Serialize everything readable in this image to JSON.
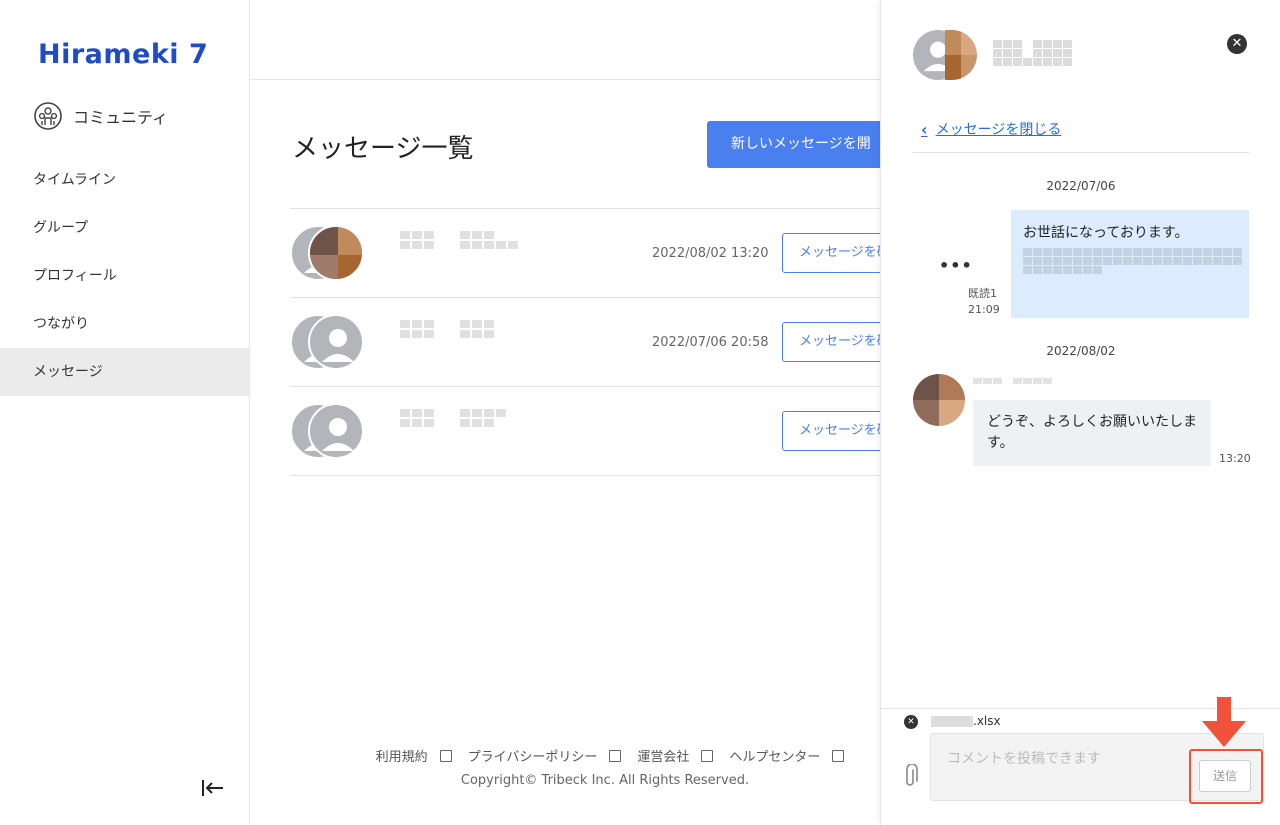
{
  "sidebar": {
    "logo": "Hirameki 7",
    "community": "コミュニティ",
    "items": [
      {
        "label": "タイムライン"
      },
      {
        "label": "グループ"
      },
      {
        "label": "プロフィール"
      },
      {
        "label": "つながり"
      },
      {
        "label": "メッセージ"
      }
    ],
    "active": "メッセージ",
    "collapse_icon": "collapse-left-icon"
  },
  "main": {
    "title": "メッセージ一覧",
    "new_button": "新しいメッセージを開",
    "rows": [
      {
        "date": "2022/08/02 13:20",
        "button": "メッセージを確"
      },
      {
        "date": "2022/07/06 20:58",
        "button": "メッセージを確"
      },
      {
        "date": "",
        "button": "メッセージを確"
      }
    ]
  },
  "footer": {
    "links": [
      "利用規約",
      "プライバシーポリシー",
      "運営会社",
      "ヘルプセンター"
    ],
    "copyright": "Copyright© Tribeck Inc. All Rights Reserved."
  },
  "panel": {
    "back_label": "メッセージを閉じる",
    "day1": "2022/07/06",
    "my_message": "お世話になっております。",
    "read_label": "既読1",
    "my_time": "21:09",
    "day2": "2022/08/02",
    "their_message": "どうぞ、よろしくお願いいたします。",
    "their_time": "13:20",
    "attachment_ext": ".xlsx",
    "comment_placeholder": "コメントを投稿できます",
    "send_label": "送信"
  },
  "colors": {
    "accent": "#4a7ff0",
    "logo": "#1f4cc4",
    "highlight": "#f0533a",
    "my_bubble": "#dcebfd"
  }
}
